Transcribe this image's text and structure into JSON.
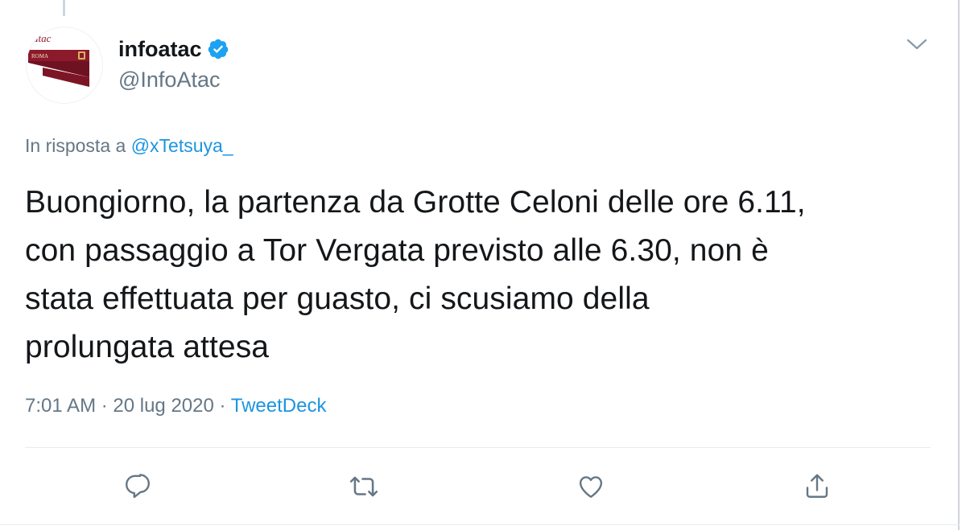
{
  "tweet": {
    "author": {
      "name": "infoatac",
      "handle": "@InfoAtac",
      "verified": true,
      "avatar_icon": "atac-roma-logo",
      "avatar_text_top": "atac",
      "avatar_text_bottom": "ROMA"
    },
    "reply_to": {
      "prefix": "In risposta a",
      "mention": "@xTetsuya_"
    },
    "text_lines": [
      "Buongiorno, la partenza da Grotte Celoni delle ore 6.11,",
      "con passaggio a Tor Vergata previsto alle 6.30, non è",
      "stata effettuata per guasto, ci scusiamo della",
      "prolungata attesa"
    ],
    "meta": {
      "time": "7:01 AM",
      "separator": " · ",
      "date": "20 lug 2020",
      "source": "TweetDeck"
    },
    "actions": [
      {
        "name": "reply",
        "icon": "reply-icon"
      },
      {
        "name": "retweet",
        "icon": "retweet-icon"
      },
      {
        "name": "like",
        "icon": "heart-icon"
      },
      {
        "name": "share",
        "icon": "share-icon"
      }
    ]
  },
  "colors": {
    "accent": "#1b95e0",
    "verified": "#1da1f2",
    "secondary_text": "#657786",
    "primary_text": "#14171a",
    "icon_gray": "#657786",
    "atac_red": "#8b1a2b"
  }
}
